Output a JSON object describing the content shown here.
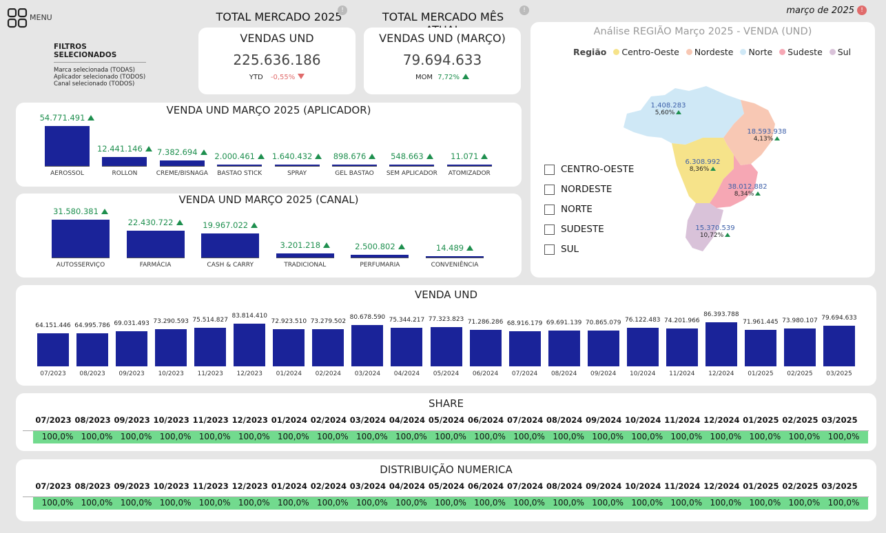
{
  "menu": {
    "label": "MENU",
    "icon": "grid-icon"
  },
  "period": "março de 2025",
  "filters": {
    "title": "FILTROS SELECIONADOS",
    "lines": [
      "Marca selecionada (TODAS)",
      "Aplicador selecionado (TODOS)",
      "Canal selecionado (TODOS)"
    ]
  },
  "kpi1": {
    "header": "TOTAL MERCADO 2025",
    "title": "VENDAS UND",
    "value": "225.636.186",
    "delta_label": "YTD",
    "delta": "-0,55%"
  },
  "kpi2": {
    "header": "TOTAL MERCADO MÊS ATUAL",
    "title": "VENDAS UND (MARÇO)",
    "value": "79.694.633",
    "delta_label": "MOM",
    "delta": "7,72%"
  },
  "aplicador": {
    "title": "VENDA UND MARÇO 2025 (APLICADOR)",
    "items": [
      {
        "label": "AEROSSOL",
        "value": 54771491,
        "text": "54.771.491"
      },
      {
        "label": "ROLLON",
        "value": 12441146,
        "text": "12.441.146"
      },
      {
        "label": "CREME/BISNAGA",
        "value": 7382694,
        "text": "7.382.694"
      },
      {
        "label": "BASTAO STICK",
        "value": 2000461,
        "text": "2.000.461"
      },
      {
        "label": "SPRAY",
        "value": 1640432,
        "text": "1.640.432"
      },
      {
        "label": "GEL BASTAO",
        "value": 898676,
        "text": "898.676"
      },
      {
        "label": "SEM APLICADOR",
        "value": 548663,
        "text": "548.663"
      },
      {
        "label": "ATOMIZADOR",
        "value": 11071,
        "text": "11.071"
      }
    ]
  },
  "canal": {
    "title": "VENDA UND MARÇO 2025 (CANAL)",
    "items": [
      {
        "label": "AUTOSSERVIÇO",
        "value": 31580381,
        "text": "31.580.381"
      },
      {
        "label": "FARMÁCIA",
        "value": 22430722,
        "text": "22.430.722"
      },
      {
        "label": "CASH & CARRY",
        "value": 19967022,
        "text": "19.967.022"
      },
      {
        "label": "TRADICIONAL",
        "value": 3201218,
        "text": "3.201.218"
      },
      {
        "label": "PERFUMARIA",
        "value": 2500802,
        "text": "2.500.802"
      },
      {
        "label": "CONVENIÊNCIA",
        "value": 14489,
        "text": "14.489"
      }
    ]
  },
  "map": {
    "title": "Análise REGIÃO Março 2025 - VENDA (UND)",
    "legend_title": "Região",
    "legend": [
      {
        "name": "Centro-Oeste",
        "color": "#f6e38a"
      },
      {
        "name": "Nordeste",
        "color": "#f8c8b4"
      },
      {
        "name": "Norte",
        "color": "#cfe8f6"
      },
      {
        "name": "Sudeste",
        "color": "#f6a7b4"
      },
      {
        "name": "Sul",
        "color": "#d9c2d9"
      }
    ],
    "regions": [
      {
        "id": "norte",
        "value": "1.408.283",
        "delta": "5,60%"
      },
      {
        "id": "nordeste",
        "value": "18.593.938",
        "delta": "4,13%"
      },
      {
        "id": "centro",
        "value": "6.308.992",
        "delta": "8,36%"
      },
      {
        "id": "sudeste",
        "value": "38.012.882",
        "delta": "8,34%"
      },
      {
        "id": "sul",
        "value": "15.370.539",
        "delta": "10,72%"
      }
    ],
    "checkboxes": [
      "CENTRO-OESTE",
      "NORDESTE",
      "NORTE",
      "SUDESTE",
      "SUL"
    ]
  },
  "chart_data": {
    "type": "bar",
    "title": "VENDA UND",
    "categories": [
      "07/2023",
      "08/2023",
      "09/2023",
      "10/2023",
      "11/2023",
      "12/2023",
      "01/2024",
      "02/2024",
      "03/2024",
      "04/2024",
      "05/2024",
      "06/2024",
      "07/2024",
      "08/2024",
      "09/2024",
      "10/2024",
      "11/2024",
      "12/2024",
      "01/2025",
      "02/2025",
      "03/2025"
    ],
    "values": [
      64151446,
      64995786,
      69031493,
      73290593,
      75514827,
      83814410,
      72923510,
      73279502,
      80678590,
      75344217,
      77323823,
      71286286,
      68916179,
      69691139,
      70865079,
      76122483,
      74201966,
      86393788,
      71961445,
      73980107,
      79694633
    ],
    "labels": [
      "64.151.446",
      "64.995.786",
      "69.031.493",
      "73.290.593",
      "75.514.827",
      "83.814.410",
      "72.923.510",
      "73.279.502",
      "80.678.590",
      "75.344.217",
      "77.323.823",
      "71.286.286",
      "68.916.179",
      "69.691.139",
      "70.865.079",
      "76.122.483",
      "74.201.966",
      "86.393.788",
      "71.961.445",
      "73.980.107",
      "79.694.633"
    ]
  },
  "share": {
    "title": "SHARE",
    "value": "100,0%"
  },
  "distribuicao": {
    "title": "DISTRIBUIÇÃO NUMERICA",
    "value": "100,0%"
  },
  "colors": {
    "bar": "#1a2399",
    "good": "#72da8e",
    "up": "#1e8f4e",
    "down": "#e06b6b"
  }
}
